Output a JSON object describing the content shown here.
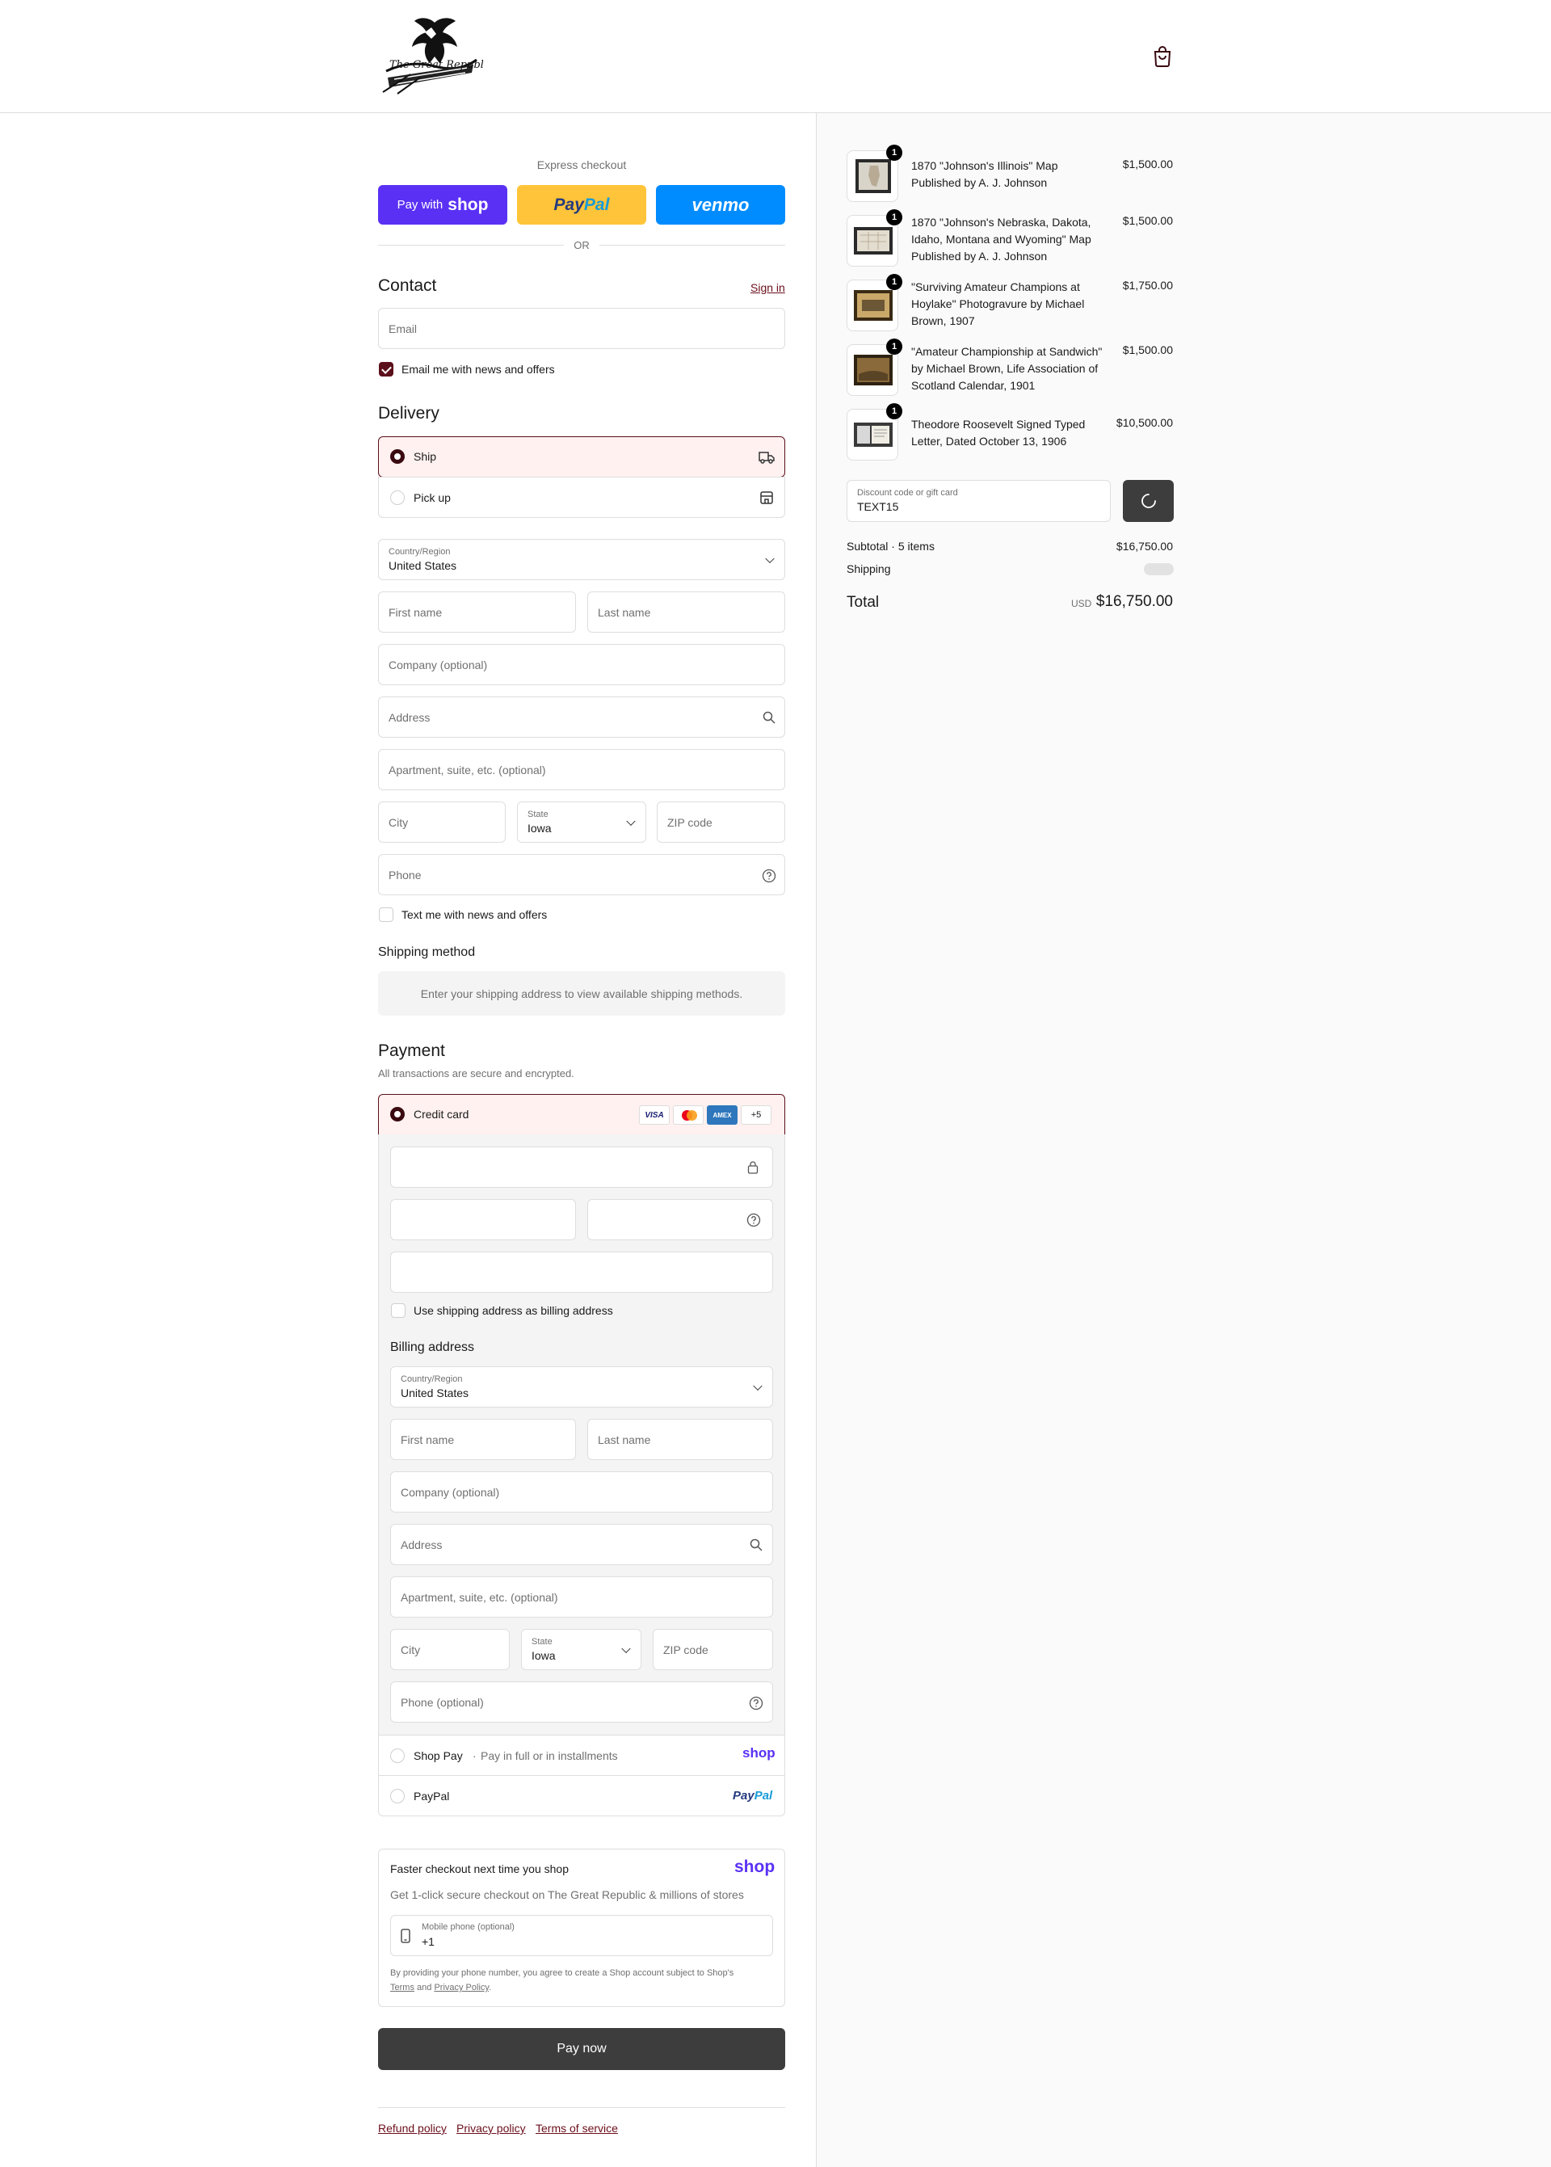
{
  "header": {
    "logo_alt": "The Great Republic",
    "cart_icon": "shopping-bag-icon"
  },
  "express": {
    "title": "Express checkout",
    "shop_pay": {
      "prefix": "Pay with",
      "brand": "shop",
      "color": "#5a31f4"
    },
    "paypal": {
      "brand_a": "Pay",
      "brand_b": "Pal",
      "color": "#ffc439"
    },
    "venmo": {
      "brand": "venmo",
      "color": "#008cff"
    },
    "or": "OR"
  },
  "contact": {
    "title": "Contact",
    "sign_in": "Sign in",
    "email_placeholder": "Email",
    "email_news_label": "Email me with news and offers",
    "email_news_checked": true
  },
  "delivery": {
    "title": "Delivery",
    "options": [
      {
        "label": "Ship",
        "selected": true,
        "icon": "truck-icon"
      },
      {
        "label": "Pick up",
        "selected": false,
        "icon": "store-icon"
      }
    ],
    "country_label": "Country/Region",
    "country_value": "United States",
    "first_name": "First name",
    "last_name": "Last name",
    "company": "Company (optional)",
    "address": "Address",
    "apartment": "Apartment, suite, etc. (optional)",
    "city": "City",
    "state_label": "State",
    "state_value": "Iowa",
    "zip": "ZIP code",
    "phone": "Phone",
    "text_news_label": "Text me with news and offers"
  },
  "shipping_method": {
    "title": "Shipping method",
    "message": "Enter your shipping address to view available shipping methods."
  },
  "payment": {
    "title": "Payment",
    "subtitle": "All transactions are secure and encrypted.",
    "credit_card_label": "Credit card",
    "card_brands": [
      "VISA",
      "mastercard",
      "AMEX"
    ],
    "more_brands": "+5",
    "use_shipping_label": "Use shipping address as billing address",
    "billing": {
      "title": "Billing address",
      "country_label": "Country/Region",
      "country_value": "United States",
      "first_name": "First name",
      "last_name": "Last name",
      "company": "Company (optional)",
      "address": "Address",
      "apartment": "Apartment, suite, etc. (optional)",
      "city": "City",
      "state_label": "State",
      "state_value": "Iowa",
      "zip": "ZIP code",
      "phone": "Phone (optional)"
    },
    "shop_pay_label": "Shop Pay",
    "shop_pay_sub": "Pay in full or in installments",
    "shop_pay_brand": "shop",
    "paypal_label": "PayPal",
    "paypal_brand_a": "Pay",
    "paypal_brand_b": "Pal"
  },
  "shop_promo": {
    "title": "Faster checkout next time you shop",
    "brand": "shop",
    "subtitle": "Get 1-click secure checkout on The Great Republic & millions of stores",
    "phone_label": "Mobile phone (optional)",
    "phone_value": "+1",
    "legal_a": "By providing your phone number, you agree to create a Shop account subject to Shop's",
    "legal_terms": "Terms",
    "legal_and": "and",
    "legal_privacy": "Privacy Policy",
    "legal_end": "."
  },
  "pay_now": "Pay now",
  "footer_links": [
    "Refund policy",
    "Privacy policy",
    "Terms of service"
  ],
  "order": {
    "items": [
      {
        "title": "1870 \"Johnson's Illinois\" Map Published by A. J. Johnson",
        "price": "$1,500.00",
        "qty": "1"
      },
      {
        "title": "1870 \"Johnson's Nebraska, Dakota, Idaho, Montana and Wyoming\" Map Published by A. J. Johnson",
        "price": "$1,500.00",
        "qty": "1"
      },
      {
        "title": "\"Surviving Amateur Champions at Hoylake\" Photogravure by Michael Brown, 1907",
        "price": "$1,750.00",
        "qty": "1"
      },
      {
        "title": "\"Amateur Championship at Sandwich\" by Michael Brown, Life Association of Scotland Calendar, 1901",
        "price": "$1,500.00",
        "qty": "1"
      },
      {
        "title": "Theodore Roosevelt Signed Typed Letter, Dated October 13, 1906",
        "price": "$10,500.00",
        "qty": "1"
      }
    ],
    "discount_label": "Discount code or gift card",
    "discount_value": "TEXT15",
    "subtotal_label": "Subtotal · 5 items",
    "subtotal_value": "$16,750.00",
    "shipping_label": "Shipping",
    "total_label": "Total",
    "currency": "USD",
    "total_value": "$16,750.00"
  }
}
